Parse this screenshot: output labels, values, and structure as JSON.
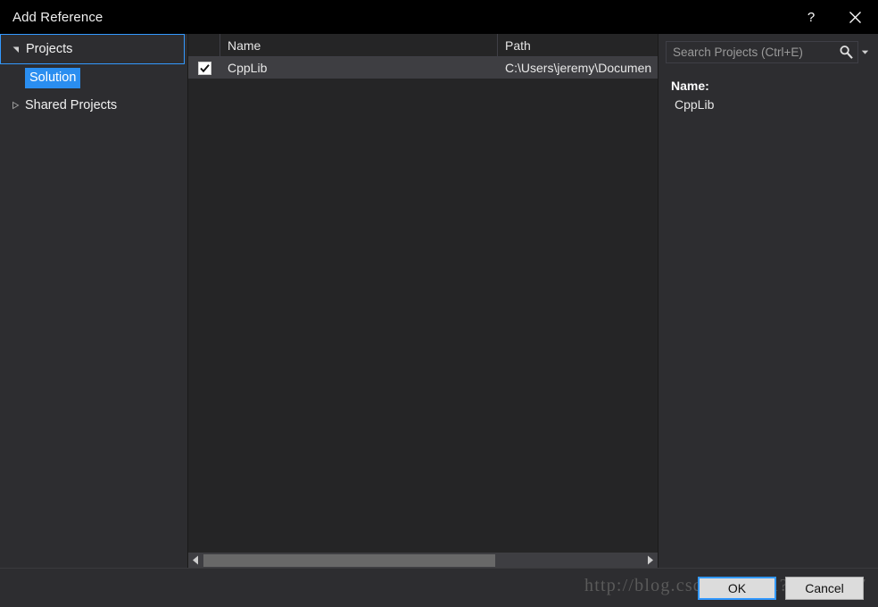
{
  "window": {
    "title": "Add Reference",
    "help_label": "?",
    "close_label": "✕"
  },
  "sidebar": {
    "items": [
      {
        "label": "Projects",
        "glyph": "triangle-down-icon",
        "state": "expanded",
        "focused": true
      },
      {
        "label": "Solution",
        "glyph": "none",
        "state": "child",
        "selected": true
      },
      {
        "label": "Shared Projects",
        "glyph": "triangle-right-icon",
        "state": "collapsed",
        "focused": false
      }
    ]
  },
  "list": {
    "columns": [
      "",
      "Name",
      "Path"
    ],
    "rows": [
      {
        "checked": true,
        "name": "CppLib",
        "path": "C:\\Users\\jeremy\\Documen"
      }
    ]
  },
  "scrollbar": {
    "left_arrow": "chevron-left-icon",
    "right_arrow": "chevron-right-icon"
  },
  "search": {
    "placeholder": "Search Projects (Ctrl+E)",
    "value": "",
    "icon": "search-icon",
    "dropdown_icon": "chevron-down-icon"
  },
  "details": {
    "name_label": "Name:",
    "name_value": "CppLib"
  },
  "footer": {
    "ok_label": "OK",
    "cancel_label": "Cancel"
  },
  "watermark": {
    "text": "http://blog.csdn.net/u01?3?56?097"
  },
  "colors": {
    "accent": "#3399ff",
    "selection": "#2a8ef0",
    "titlebar": "#000000",
    "panel": "#2d2d30",
    "list": "#252526",
    "row_highlight": "#3e3e42"
  }
}
